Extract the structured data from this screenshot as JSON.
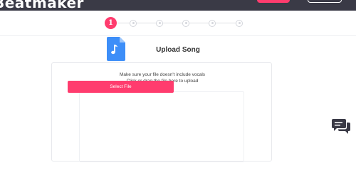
{
  "header": {
    "logo_text": "Beatmaker"
  },
  "stepper": {
    "active_label": "1",
    "total_steps": 6,
    "current_step": 1
  },
  "upload": {
    "title": "Upload Song",
    "hint_line1": "Make sure your file doesn't include vocals",
    "hint_line2": "Click or drag the file here to upload",
    "select_button": "Select File",
    "file_icon": "music-file-icon"
  },
  "chat": {
    "icon": "chat-icon"
  },
  "colors": {
    "accent": "#ff3c6e",
    "header_bg": "#3a3a46",
    "file_icon": "#3d8ef8"
  }
}
